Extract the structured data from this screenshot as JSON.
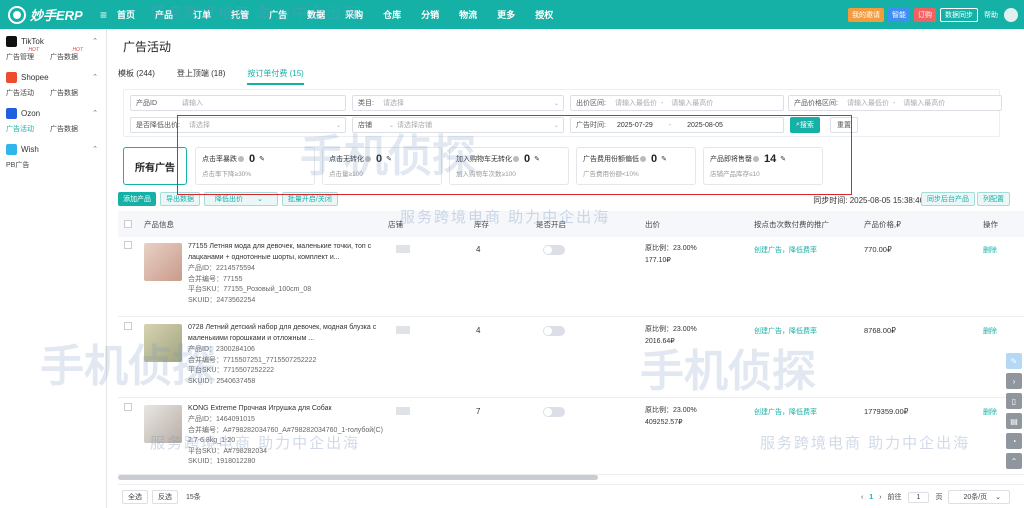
{
  "header": {
    "logo_text": "妙手ERP",
    "nav": [
      "首页",
      "产品",
      "订单",
      "托管",
      "广告",
      "数据",
      "采购",
      "仓库",
      "分销",
      "物流",
      "更多",
      "授权"
    ],
    "buttons": {
      "invite": "我的邀请",
      "smart": "智能",
      "order": "订购",
      "sync": "数据同步"
    },
    "help": "帮助"
  },
  "sidebar": {
    "platforms": [
      {
        "name": "TikTok",
        "color": "#111111",
        "subs": [
          "广告管理",
          "广告数据"
        ]
      },
      {
        "name": "Shopee",
        "color": "#ee4d2d",
        "subs": [
          "广告活动",
          "广告数据"
        ]
      },
      {
        "name": "Ozon",
        "color": "#1f5fe0",
        "subs": [
          "广告活动",
          "广告数据"
        ]
      },
      {
        "name": "Wish",
        "color": "#2fb7ec",
        "subs": [
          "PB广告"
        ]
      }
    ],
    "hot": "HOT"
  },
  "page": {
    "title": "广告活动"
  },
  "tabs": [
    "模板 (244)",
    "登上顶端 (18)",
    "按订单付费 (15)"
  ],
  "filters": {
    "product_id": {
      "label": "产品ID",
      "placeholder": "请输入"
    },
    "category": {
      "label": "类目:",
      "placeholder": "请选择"
    },
    "sale_range": {
      "label": "出价区间:",
      "ph_min": "请输入最低价",
      "sep": "-",
      "ph_max": "请输入最高价"
    },
    "price_range": {
      "label": "产品价格区间:",
      "ph_min": "请输入最低价",
      "sep": "-",
      "ph_max": "请输入最高价"
    },
    "lower_bid": {
      "label": "是否降低出价:",
      "placeholder": "请选择"
    },
    "store": {
      "label": "店铺",
      "placeholder": "请选择店铺"
    },
    "time": {
      "label": "广告时间:",
      "start": "2025-07-29",
      "sep": "-",
      "end": "2025-08-05"
    },
    "search": "搜索",
    "reset": "重置"
  },
  "all_ads": "所有广告",
  "cards": [
    {
      "title": "点击率暴跌",
      "value": "0",
      "sub": "点击率下降≥30%"
    },
    {
      "title": "点击无转化",
      "value": "0",
      "sub": "点击量≥100"
    },
    {
      "title": "加入购物车无转化",
      "value": "0",
      "sub": "加入购物车次数≥100"
    },
    {
      "title": "广告费用份额偏低",
      "value": "0",
      "sub": "广告费用份额<10%"
    },
    {
      "title": "产品即将售罄",
      "value": "14",
      "sub": "店铺产品库存≤10"
    }
  ],
  "toolbar": {
    "add": "添加产品",
    "export": "导出数据",
    "lower": "降低出价",
    "batch": "批量开启/关闭",
    "sync_time_label": "同步时间:",
    "sync_time": "2025-08-05 15:38:46",
    "sync_btn": "同步后台产品",
    "col_config": "列配置"
  },
  "columns": [
    "产品信息",
    "店铺",
    "库存",
    "是否开启",
    "出价",
    "按点击次数付费的推广",
    "产品价格,₽",
    "操作"
  ],
  "rows": [
    {
      "name": "77155 Летняя мода для девочек, маленькие точки, топ с лацканами + однотонные шорты, комплект и...",
      "pid": "产品ID：2214575594",
      "merge": "合并编号：77155",
      "sku": "平台SKU：77155_Розовый_100cm_08",
      "skuid": "SKUID：2473562254",
      "stock": "4",
      "ratio": "原比例：23.00%",
      "bid": "177.10₽",
      "link": "创建广告，降低费率",
      "price": "770.00₽",
      "op": "删除",
      "thumb": "#d9b6a8"
    },
    {
      "name": "0728 Летний детский набор для девочек, модная блузка с маленькими горошками и отложным ...",
      "pid": "产品ID：2300284106",
      "merge": "合并编号：7715507251_7715507252222",
      "sku": "平台SKU：7715507252222",
      "skuid": "SKUID：2540637458",
      "stock": "4",
      "ratio": "原比例：23.00%",
      "bid": "2016.64₽",
      "link": "创建广告，降低费率",
      "price": "8768.00₽",
      "op": "删除",
      "thumb": "#b8b89a"
    },
    {
      "name": "KONG Extreme Прочная Игрушка для Собак",
      "pid": "产品ID：1464091015",
      "merge": "合并编号：A#798282034760_A#798282034760_1-голубой(C) 2.7-6.8kg_1-20",
      "sku": "平台SKU：A#798282034",
      "skuid": "SKUID：1918012280",
      "stock": "7",
      "ratio": "原比例：23.00%",
      "bid": "409252.57₽",
      "link": "创建广告，降低费率",
      "price": "1779359.00₽",
      "op": "删除",
      "thumb": "#cfcac4"
    }
  ],
  "footer": {
    "all": "全选",
    "invert": "反选",
    "count": "15条",
    "page": "1",
    "goto": "前往",
    "page_input": "1",
    "page_unit": "页",
    "per_page": "20条/页"
  },
  "watermark": {
    "slogan": "服务跨境电商 助力中企出海",
    "brand": "手机侦探"
  }
}
